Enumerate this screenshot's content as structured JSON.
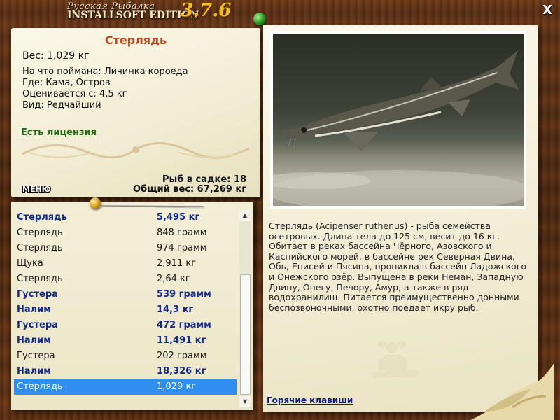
{
  "window": {
    "title_line1": "Русская Рыбалка",
    "title_line2": "INSTALLSOFT EDITION",
    "version": "3.7.6",
    "close_label": "X"
  },
  "fish": {
    "name": "Стерлядь",
    "weight": "Вес: 1,029 кг",
    "bait": "На что поймана: Личинка короеда",
    "location": "Где: Кама, Остров",
    "rated_from": "Оценивается с: 4,5 кг",
    "rarity": "Вид: Редчайший",
    "license": "Есть лицензия"
  },
  "menu_label": "МЕНЮ",
  "stats": {
    "count": "Рыб в садке: 18",
    "total_weight": "Общий вес: 67,269 кг"
  },
  "catch_list": [
    {
      "name": "Стерлядь",
      "weight": "5,495 кг",
      "bold": true
    },
    {
      "name": "Стерлядь",
      "weight": "848 грамм",
      "bold": false
    },
    {
      "name": "Стерлядь",
      "weight": "974 грамм",
      "bold": false
    },
    {
      "name": "Щука",
      "weight": "2,911 кг",
      "bold": false
    },
    {
      "name": "Стерлядь",
      "weight": "2,64 кг",
      "bold": false
    },
    {
      "name": "Густера",
      "weight": "539 грамм",
      "bold": true
    },
    {
      "name": "Налим",
      "weight": "14,3 кг",
      "bold": true
    },
    {
      "name": "Густера",
      "weight": "472 грамм",
      "bold": true
    },
    {
      "name": "Налим",
      "weight": "11,491 кг",
      "bold": true
    },
    {
      "name": "Густера",
      "weight": "202 грамм",
      "bold": false
    },
    {
      "name": "Налим",
      "weight": "18,326 кг",
      "bold": true
    },
    {
      "name": "Стерлядь",
      "weight": "1,029 кг",
      "bold": false,
      "selected": true
    }
  ],
  "description": "Стерлядь (Acipenser ruthenus) - рыба семейства осетровых. Длина тела до 125 см, весит до 16 кг. Обитает в реках бассейна Чёрного, Азовского и Каспийского морей, в бассейне рек Северная Двина, Обь, Енисей и Пясина, проникла в бассейн Ладожского и Онежского озёр. Выпущена в реки Неман, Западную Двину, Онегу, Печору, Амур, а также в ряд водохранилищ. Питается преимущественно донными беспозвоночными, охотно поедает икру рыб.",
  "hotkeys_label": "Горячие клавиши",
  "colors": {
    "fish_name": "#c0491b",
    "license": "#1d6b12",
    "bold_row": "#122a8a",
    "selected_row": "#2f8ef0",
    "version": "#f0c020"
  }
}
